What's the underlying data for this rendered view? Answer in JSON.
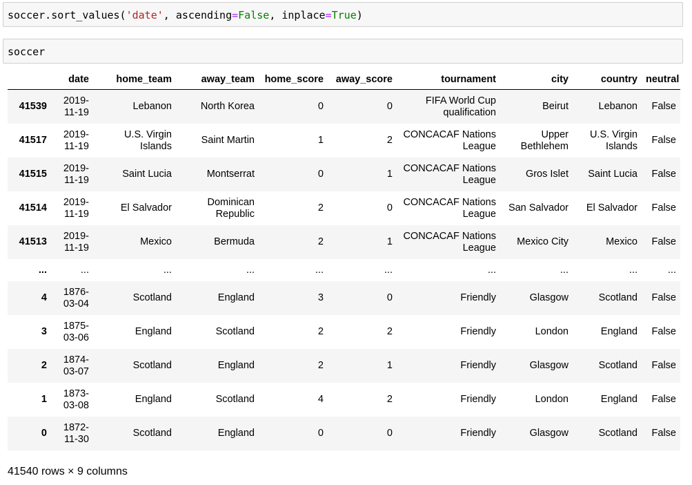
{
  "cell1": {
    "prefix": "soccer.sort_values(",
    "arg_date": "'date'",
    "comma1": ", ",
    "kw_ascending": "ascending",
    "eq1": "=",
    "val_false": "False",
    "comma2": ", ",
    "kw_inplace": "inplace",
    "eq2": "=",
    "val_true": "True",
    "suffix": ")"
  },
  "cell2": {
    "code": "soccer"
  },
  "table": {
    "columns": [
      "",
      "date",
      "home_team",
      "away_team",
      "home_score",
      "away_score",
      "tournament",
      "city",
      "country",
      "neutral"
    ],
    "rows": [
      [
        "41539",
        "2019-11-19",
        "Lebanon",
        "North Korea",
        "0",
        "0",
        "FIFA World Cup qualification",
        "Beirut",
        "Lebanon",
        "False"
      ],
      [
        "41517",
        "2019-11-19",
        "U.S. Virgin Islands",
        "Saint Martin",
        "1",
        "2",
        "CONCACAF Nations League",
        "Upper Bethlehem",
        "U.S. Virgin Islands",
        "False"
      ],
      [
        "41515",
        "2019-11-19",
        "Saint Lucia",
        "Montserrat",
        "0",
        "1",
        "CONCACAF Nations League",
        "Gros Islet",
        "Saint Lucia",
        "False"
      ],
      [
        "41514",
        "2019-11-19",
        "El Salvador",
        "Dominican Republic",
        "2",
        "0",
        "CONCACAF Nations League",
        "San Salvador",
        "El Salvador",
        "False"
      ],
      [
        "41513",
        "2019-11-19",
        "Mexico",
        "Bermuda",
        "2",
        "1",
        "CONCACAF Nations League",
        "Mexico City",
        "Mexico",
        "False"
      ],
      [
        "...",
        "...",
        "...",
        "...",
        "...",
        "...",
        "...",
        "...",
        "...",
        "..."
      ],
      [
        "4",
        "1876-03-04",
        "Scotland",
        "England",
        "3",
        "0",
        "Friendly",
        "Glasgow",
        "Scotland",
        "False"
      ],
      [
        "3",
        "1875-03-06",
        "England",
        "Scotland",
        "2",
        "2",
        "Friendly",
        "London",
        "England",
        "False"
      ],
      [
        "2",
        "1874-03-07",
        "Scotland",
        "England",
        "2",
        "1",
        "Friendly",
        "Glasgow",
        "Scotland",
        "False"
      ],
      [
        "1",
        "1873-03-08",
        "England",
        "Scotland",
        "4",
        "2",
        "Friendly",
        "London",
        "England",
        "False"
      ],
      [
        "0",
        "1872-11-30",
        "Scotland",
        "England",
        "0",
        "0",
        "Friendly",
        "Glasgow",
        "Scotland",
        "False"
      ]
    ]
  },
  "shape_text": "41540 rows × 9 columns",
  "colors": {
    "cell_background": "#f7f7f7",
    "cell_border": "#cfcfcf",
    "string_color": "#ba2121",
    "keyword_color": "#008000",
    "operator_color": "#aa22ff",
    "striped_row": "#f5f5f5"
  }
}
